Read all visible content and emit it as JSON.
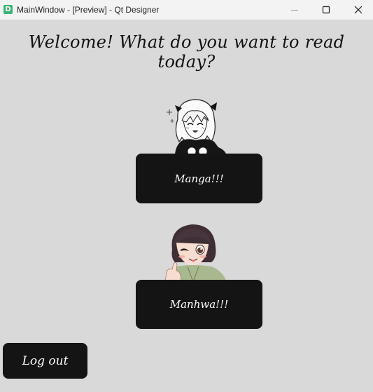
{
  "window": {
    "app_icon_letter": "D",
    "title": "MainWindow - [Preview] - Qt Designer"
  },
  "main": {
    "heading": "Welcome! What do you want to read today?",
    "manga_button": "Manga!!!",
    "manhwa_button": "Manhwa!!!",
    "logout_button": "Log out"
  },
  "icons": {
    "app": "qt-designer-icon",
    "minimize": "minimize-icon",
    "maximize": "maximize-icon",
    "close": "close-icon",
    "manga_art": "anime-girl-illustration",
    "manhwa_art": "winking-girl-illustration"
  },
  "colors": {
    "background": "#d9d9d9",
    "button_bg": "#141414",
    "button_text": "#ffffff",
    "titlebar": "#f3f3f3"
  }
}
